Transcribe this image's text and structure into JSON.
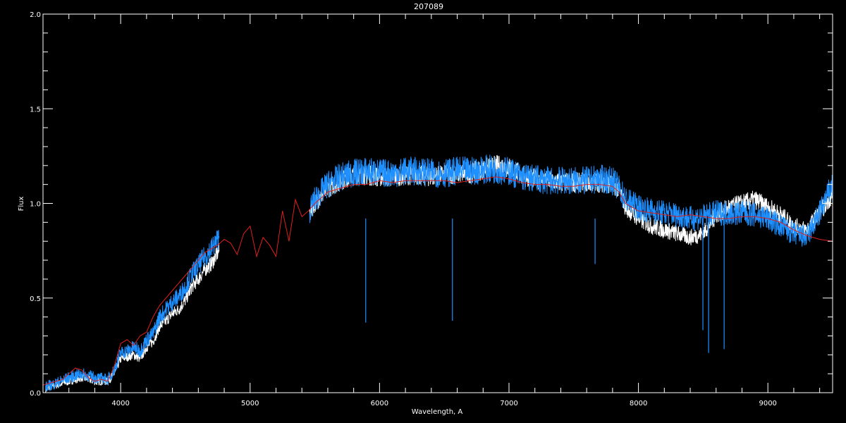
{
  "chart_data": {
    "type": "line",
    "title": "207089",
    "xlabel": "Wavelength, A",
    "ylabel": "Flux",
    "xlim": [
      3400,
      9500
    ],
    "ylim": [
      0.0,
      2.0
    ],
    "x_ticks": [
      4000,
      5000,
      6000,
      7000,
      8000,
      9000
    ],
    "x_tick_labels": [
      "4000",
      "5000",
      "6000",
      "7000",
      "8000",
      "9000"
    ],
    "y_ticks": [
      0.0,
      0.5,
      1.0,
      1.5,
      2.0
    ],
    "y_tick_labels": [
      "0.0",
      "0.5",
      "1.0",
      "1.5",
      "2.0"
    ],
    "grid": false,
    "background": "#000000",
    "series": [
      {
        "color": "#ffffff",
        "segments": [
          {
            "x": [
              3420,
              3500,
              3600,
              3700,
              3800,
              3900,
              3950,
              4000,
              4050,
              4100,
              4150,
              4200,
              4250,
              4300,
              4350,
              4400,
              4450,
              4500,
              4550,
              4600,
              4650,
              4700,
              4760
            ],
            "y": [
              0.02,
              0.04,
              0.06,
              0.08,
              0.06,
              0.06,
              0.1,
              0.18,
              0.19,
              0.2,
              0.18,
              0.24,
              0.27,
              0.35,
              0.38,
              0.42,
              0.44,
              0.49,
              0.56,
              0.6,
              0.65,
              0.68,
              0.75
            ]
          },
          {
            "x": [
              5460,
              5500,
              5600,
              5700,
              5800,
              5900,
              6000,
              6100,
              6200,
              6300,
              6400,
              6500,
              6600,
              6700,
              6800,
              6900,
              7000,
              7100,
              7200,
              7300,
              7400,
              7500,
              7600,
              7700,
              7800,
              7850,
              7900,
              8000,
              8100,
              8200,
              8300,
              8400,
              8500,
              8600,
              8700,
              8800,
              8900,
              9000,
              9100,
              9200,
              9300,
              9400,
              9500
            ],
            "y": [
              0.95,
              1.0,
              1.08,
              1.12,
              1.15,
              1.15,
              1.14,
              1.14,
              1.15,
              1.15,
              1.14,
              1.15,
              1.16,
              1.16,
              1.18,
              1.2,
              1.19,
              1.15,
              1.13,
              1.12,
              1.11,
              1.11,
              1.11,
              1.11,
              1.1,
              1.08,
              0.98,
              0.92,
              0.88,
              0.86,
              0.84,
              0.82,
              0.84,
              0.94,
              0.98,
              1.0,
              1.02,
              0.98,
              0.94,
              0.88,
              0.86,
              0.95,
              1.05
            ]
          }
        ]
      },
      {
        "color": "#1e90ff",
        "segments": [
          {
            "x": [
              3420,
              3500,
              3600,
              3700,
              3800,
              3900,
              3950,
              4000,
              4050,
              4100,
              4150,
              4200,
              4250,
              4300,
              4350,
              4400,
              4450,
              4500,
              4550,
              4600,
              4650,
              4700,
              4760
            ],
            "y": [
              0.03,
              0.05,
              0.08,
              0.1,
              0.08,
              0.07,
              0.12,
              0.21,
              0.22,
              0.24,
              0.22,
              0.28,
              0.31,
              0.4,
              0.44,
              0.48,
              0.51,
              0.56,
              0.63,
              0.67,
              0.72,
              0.76,
              0.82
            ]
          },
          {
            "x": [
              5460,
              5500,
              5600,
              5700,
              5800,
              5900,
              6000,
              6100,
              6200,
              6300,
              6400,
              6500,
              6600,
              6700,
              6800,
              6900,
              7000,
              7100,
              7200,
              7300,
              7400,
              7500,
              7600,
              7700,
              7800,
              7850,
              7900,
              8000,
              8100,
              8200,
              8300,
              8400,
              8500,
              8600,
              8700,
              8800,
              8900,
              9000,
              9100,
              9200,
              9300,
              9400,
              9500
            ],
            "y": [
              0.96,
              1.02,
              1.1,
              1.14,
              1.16,
              1.17,
              1.16,
              1.16,
              1.17,
              1.17,
              1.16,
              1.16,
              1.17,
              1.17,
              1.18,
              1.18,
              1.17,
              1.14,
              1.13,
              1.12,
              1.12,
              1.12,
              1.12,
              1.13,
              1.12,
              1.08,
              1.02,
              0.98,
              0.96,
              0.95,
              0.94,
              0.92,
              0.93,
              0.95,
              0.95,
              0.95,
              0.94,
              0.92,
              0.88,
              0.84,
              0.82,
              0.95,
              1.1
            ]
          }
        ],
        "absorption_lines": [
          {
            "x": 5893,
            "y": 0.37
          },
          {
            "x": 6563,
            "y": 0.38
          },
          {
            "x": 7665,
            "y": 0.68
          },
          {
            "x": 8498,
            "y": 0.33
          },
          {
            "x": 8542,
            "y": 0.21
          },
          {
            "x": 8662,
            "y": 0.23
          }
        ]
      },
      {
        "color": "#e0201e",
        "x": [
          3400,
          3450,
          3500,
          3550,
          3600,
          3650,
          3700,
          3750,
          3800,
          3850,
          3900,
          3950,
          4000,
          4050,
          4100,
          4150,
          4200,
          4250,
          4300,
          4350,
          4400,
          4450,
          4500,
          4550,
          4600,
          4650,
          4700,
          4750,
          4800,
          4850,
          4900,
          4950,
          5000,
          5050,
          5100,
          5150,
          5200,
          5250,
          5300,
          5350,
          5400,
          5450,
          5500,
          5600,
          5700,
          5800,
          5900,
          6000,
          6100,
          6200,
          6300,
          6400,
          6500,
          6600,
          6700,
          6800,
          6900,
          7000,
          7100,
          7200,
          7300,
          7400,
          7500,
          7600,
          7700,
          7800,
          7850,
          7900,
          8000,
          8100,
          8200,
          8300,
          8400,
          8500,
          8600,
          8700,
          8800,
          8900,
          9000,
          9100,
          9200,
          9300,
          9400,
          9500
        ],
        "y": [
          0.04,
          0.05,
          0.06,
          0.07,
          0.1,
          0.13,
          0.12,
          0.08,
          0.06,
          0.07,
          0.06,
          0.14,
          0.26,
          0.28,
          0.25,
          0.3,
          0.32,
          0.4,
          0.46,
          0.5,
          0.54,
          0.58,
          0.62,
          0.66,
          0.7,
          0.74,
          0.76,
          0.78,
          0.81,
          0.79,
          0.73,
          0.84,
          0.88,
          0.72,
          0.82,
          0.78,
          0.72,
          0.96,
          0.8,
          1.02,
          0.93,
          0.96,
          1.0,
          1.06,
          1.08,
          1.1,
          1.1,
          1.12,
          1.11,
          1.12,
          1.12,
          1.12,
          1.12,
          1.11,
          1.12,
          1.13,
          1.14,
          1.13,
          1.11,
          1.1,
          1.1,
          1.09,
          1.09,
          1.1,
          1.1,
          1.09,
          1.06,
          1.0,
          0.96,
          0.95,
          0.94,
          0.93,
          0.94,
          0.93,
          0.92,
          0.92,
          0.93,
          0.93,
          0.92,
          0.9,
          0.86,
          0.83,
          0.81,
          0.8
        ]
      }
    ]
  }
}
